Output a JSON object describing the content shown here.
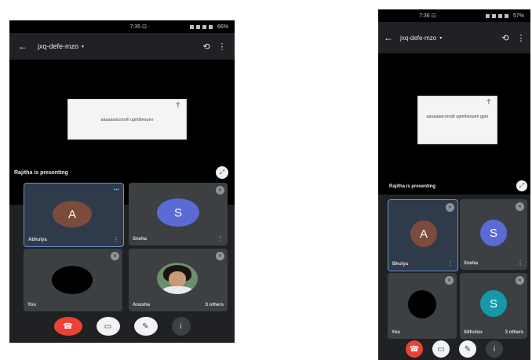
{
  "colors": {
    "app_bg": "#1f2124",
    "tile_bg": "#3c4043",
    "end_call": "#ea4335",
    "avatar_a": "#7b4b3c",
    "avatar_s_purple": "#5b6bd6",
    "avatar_s_teal": "#1598a8",
    "speaking_accent": "#6fa0ff"
  },
  "left": {
    "status": {
      "time": "7:35 ⊡ ·",
      "battery": "66%"
    },
    "header": {
      "meeting_code": "jxq-defe-mzo"
    },
    "presentation": {
      "slide_text": "aasaaaaconoill ugmlbesuen",
      "presenter": "Rajitha is presenting"
    },
    "tiles": [
      {
        "name": "Abhulya",
        "initial": "A"
      },
      {
        "name": "Sneha",
        "initial": "S"
      },
      {
        "name": "You",
        "initial": ""
      },
      {
        "name": "Anusha",
        "extra": "3 others"
      }
    ]
  },
  "right": {
    "status": {
      "time": "7:36 ⊡ ·",
      "battery": "57%"
    },
    "header": {
      "meeting_code": "jxq-defe-mzo"
    },
    "presentation": {
      "slide_text": "aasaaaaconoill ugmlbesuen gpio",
      "presenter": "Rajitha is presenting"
    },
    "tiles": [
      {
        "name": "Bhulya",
        "initial": "A"
      },
      {
        "name": "Sneha",
        "initial": "S"
      },
      {
        "name": "You",
        "initial": ""
      },
      {
        "name": "Sithulsu",
        "initial": "S",
        "extra": "3 others"
      }
    ]
  },
  "icons": {
    "back": "←",
    "caret": "▾",
    "flip_camera": "⟲",
    "more": "⋮",
    "expand": "⤢",
    "mic_off": "✕",
    "speaking": "•••",
    "end_call": "☎",
    "camera": "▭",
    "mic": "✎",
    "info": "i"
  }
}
